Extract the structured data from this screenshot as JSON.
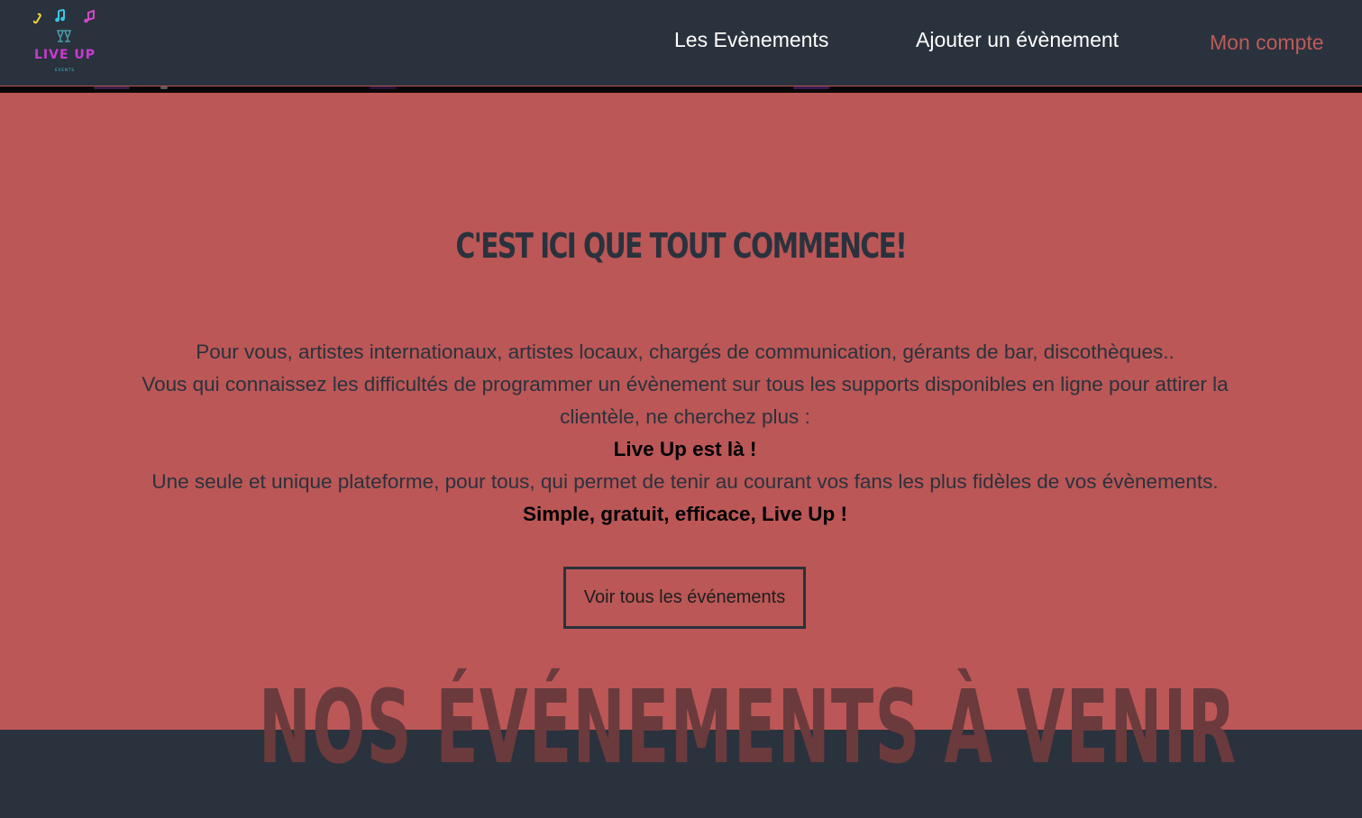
{
  "header": {
    "logo_text": "LIVE UP",
    "logo_subtext": "EVENTS",
    "nav": {
      "events": "Les Evènements",
      "add_event": "Ajouter un évènement",
      "account": "Mon compte"
    }
  },
  "hero": {
    "title": "C'est ici que tout commence!",
    "lines": [
      "Pour vous, artistes internationaux, artistes locaux, chargés de communication, gérants de bar, discothèques..",
      "Vous qui connaissez les difficultés de programmer un évènement sur tous les supports disponibles en ligne pour attirer la clientèle, ne cherchez plus :"
    ],
    "highlight_1": "Live Up est là !",
    "line_3": "Une seule et unique plateforme, pour tous, qui permet de tenir au courant vos fans les plus fidèles de vos évènements.",
    "highlight_2": "Simple, gratuit, efficace, Live Up !",
    "cta_label": "Voir tous les événements"
  },
  "upcoming": {
    "title": "Nos événements à venir"
  },
  "colors": {
    "navbar_bg": "#2a323d",
    "hero_bg": "#bb5756",
    "accent": "#bd5b58",
    "section_title": "#6b3a3d"
  },
  "icons": {
    "logo": "music-notes-cocktail-logo"
  }
}
